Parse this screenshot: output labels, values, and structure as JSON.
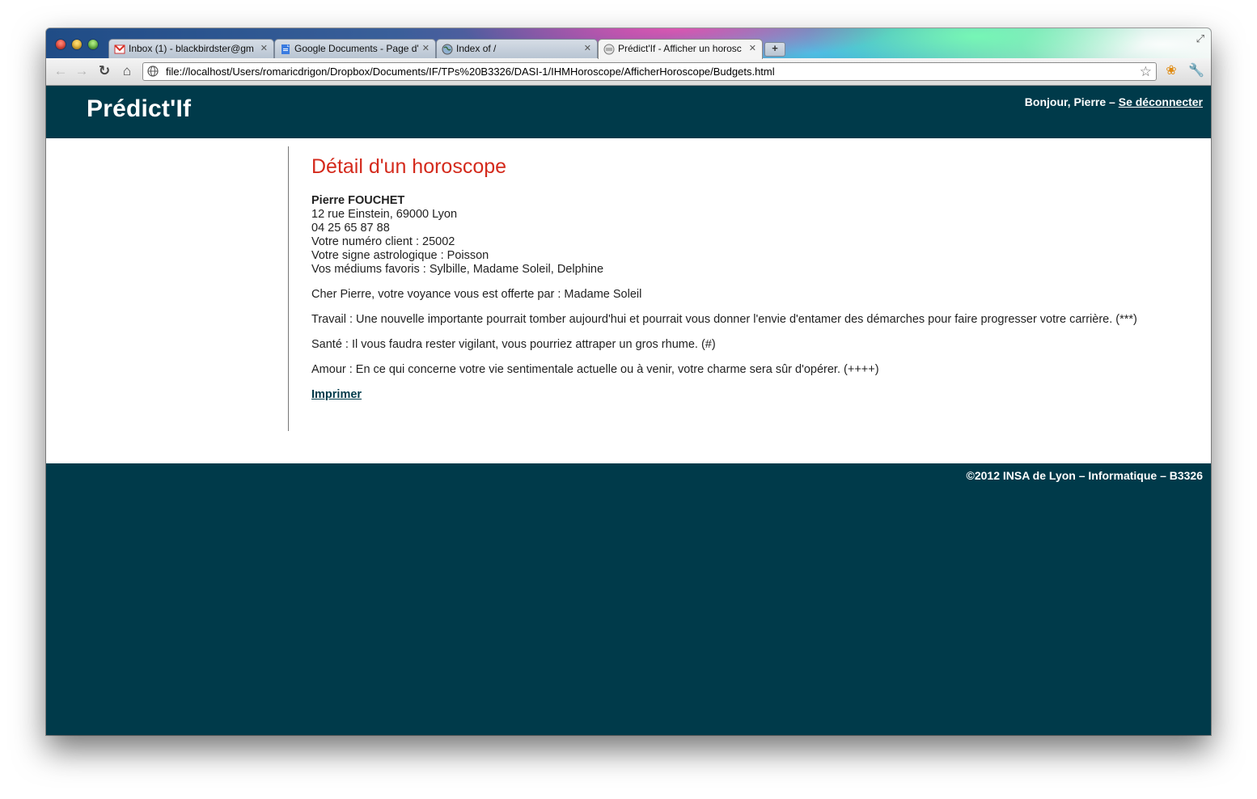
{
  "browser": {
    "tabs": [
      {
        "title": "Inbox (1) - blackbirdster@gm",
        "icon": "gmail-icon",
        "active": false
      },
      {
        "title": "Google Documents - Page d'",
        "icon": "google-docs-icon",
        "active": false
      },
      {
        "title": "Index of /",
        "icon": "globe-icon",
        "active": false
      },
      {
        "title": "Prédict'If - Afficher un horosc",
        "icon": "page-icon",
        "active": true
      }
    ],
    "new_tab_label": "+",
    "address": "file://localhost/Users/romaricdrigon/Dropbox/Documents/IF/TPs%20B3326/DASI-1/IHMHoroscope/AfficherHoroscope/Budgets.html"
  },
  "header": {
    "logo": "Prédict'If",
    "greeting": "Bonjour, Pierre – ",
    "logout_label": "Se déconnecter"
  },
  "main": {
    "title": "Détail d'un horoscope",
    "client": {
      "name": "Pierre FOUCHET",
      "address": "12 rue Einstein, 69000 Lyon",
      "phone": "04 25 65 87 88",
      "client_number": "Votre numéro client : 25002",
      "sign": "Votre signe astrologique : Poisson",
      "favorite_mediums": "Vos médiums favoris : Sylbille, Madame Soleil, Delphine"
    },
    "offered_by": "Cher Pierre, votre voyance vous est offerte par : Madame Soleil",
    "work": "Travail : Une nouvelle importante pourrait tomber aujourd'hui et pourrait vous donner l'envie d'entamer des démarches pour faire progresser votre carrière. (***)",
    "health": "Santé : Il vous faudra rester vigilant, vous pourriez attraper un gros rhume. (#)",
    "love": "Amour : En ce qui concerne votre vie sentimentale actuelle ou à venir, votre charme sera sûr d'opérer. (++++)",
    "print_label": "Imprimer"
  },
  "footer": {
    "copyright": "©2012 INSA de Lyon – Informatique – B3326"
  },
  "colors": {
    "brand": "#003a4a",
    "title_red": "#d42a1c"
  }
}
